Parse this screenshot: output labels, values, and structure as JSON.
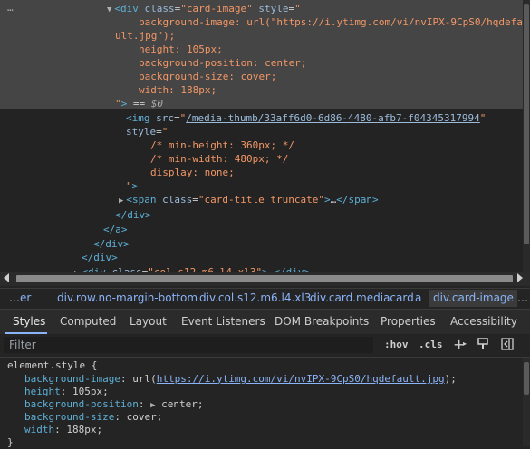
{
  "elements_panel": {
    "dots": "…",
    "lines": [
      {
        "parts": [
          [
            "tri",
            "▼"
          ],
          [
            "tag",
            "<div "
          ],
          [
            "attr",
            "class"
          ],
          [
            "plain",
            "="
          ],
          [
            "val",
            "\"card-image\""
          ],
          [
            "attr",
            " style"
          ],
          [
            "plain",
            "="
          ],
          [
            "val",
            "\""
          ]
        ]
      },
      {
        "parts": [
          [
            "val",
            "background-image: url(\"https://i.ytimg.com/vi/nvIPX-9CpS0/hqdefa"
          ]
        ]
      },
      {
        "parts": [
          [
            "val",
            "ult.jpg\");"
          ]
        ]
      },
      {
        "parts": [
          [
            "val",
            "height: 105px;"
          ]
        ]
      },
      {
        "parts": [
          [
            "val",
            "background-position: center;"
          ]
        ]
      },
      {
        "parts": [
          [
            "val",
            "background-size: cover;"
          ]
        ]
      },
      {
        "parts": [
          [
            "val",
            "width: 188px;"
          ]
        ]
      },
      {
        "parts": [
          [
            "val",
            "\""
          ],
          [
            "tag",
            ">"
          ],
          [
            "plain",
            " == "
          ],
          [
            "eq0",
            "$0"
          ]
        ]
      },
      {
        "parts": [
          [
            "tag",
            "<img "
          ],
          [
            "attr",
            "src"
          ],
          [
            "plain",
            "="
          ],
          [
            "val",
            "\""
          ],
          [
            "link",
            "/media-thumb/33aff6d0-6d86-4480-afb7-f04345317994"
          ],
          [
            "val",
            "\""
          ]
        ]
      },
      {
        "parts": [
          [
            "attr",
            "style"
          ],
          [
            "plain",
            "="
          ],
          [
            "val",
            "\""
          ]
        ]
      },
      {
        "parts": [
          [
            "comment",
            "/* min-height: 360px; */"
          ]
        ]
      },
      {
        "parts": [
          [
            "comment",
            "/* min-width: 480px; */"
          ]
        ]
      },
      {
        "parts": [
          [
            "val",
            "display: none;"
          ]
        ]
      },
      {
        "parts": [
          [
            "val",
            "\""
          ],
          [
            "tag",
            ">"
          ]
        ]
      },
      {
        "parts": [
          [
            "tri",
            "▶"
          ],
          [
            "tag",
            "<span "
          ],
          [
            "attr",
            "class"
          ],
          [
            "plain",
            "="
          ],
          [
            "val",
            "\"card-title truncate\""
          ],
          [
            "tag",
            ">"
          ],
          [
            "plain",
            "…"
          ],
          [
            "tag",
            "</span>"
          ]
        ]
      },
      {
        "parts": [
          [
            "tag",
            "</div>"
          ]
        ]
      },
      {
        "parts": [
          [
            "tag",
            "</a>"
          ]
        ]
      },
      {
        "parts": [
          [
            "tag",
            "</div>"
          ]
        ]
      },
      {
        "parts": [
          [
            "tag",
            "</div>"
          ]
        ]
      },
      {
        "parts": [
          [
            "tri",
            "▶"
          ],
          [
            "tag",
            "<div "
          ],
          [
            "attr",
            "class"
          ],
          [
            "plain",
            "="
          ],
          [
            "val",
            "\"col s12 m6 l4 xl3\""
          ],
          [
            "tag",
            ">"
          ],
          [
            "plain",
            "…"
          ],
          [
            "tag",
            "</div>"
          ]
        ]
      }
    ]
  },
  "breadcrumbs": {
    "dots": "…",
    "items": [
      "er",
      "div.row.no-margin-bottom",
      "div.col.s12.m6.l4.xl3",
      "div.card.mediacard",
      "a",
      "div.card-image",
      "…"
    ]
  },
  "tabs": [
    "Styles",
    "Computed",
    "Layout",
    "Event Listeners",
    "DOM Breakpoints",
    "Properties",
    "Accessibility"
  ],
  "active_tab": "Styles",
  "filter": {
    "placeholder": "Filter",
    "hov": ":hov",
    "cls": ".cls",
    "plus_icon": "+",
    "paint_icon": "paint-brush-icon",
    "sidebar_icon": "toggle-sidebar-icon"
  },
  "styles": {
    "selector": "element.style",
    "open": " {",
    "rules": [
      {
        "prop": "background-image",
        "pre": "url(",
        "link": "https://i.ytimg.com/vi/nvIPX-9CpS0/hqdefault.jpg",
        "post": ");"
      },
      {
        "prop": "height",
        "value": "105px;"
      },
      {
        "prop": "background-position",
        "tri": "▶",
        "value": "center;"
      },
      {
        "prop": "background-size",
        "value": "cover;"
      },
      {
        "prop": "width",
        "value": "188px;"
      }
    ],
    "close": "}"
  },
  "colors": {
    "accent": "#8ab4f8",
    "tag": "#5db0d7",
    "value": "#f29766",
    "selection": "#454545"
  }
}
